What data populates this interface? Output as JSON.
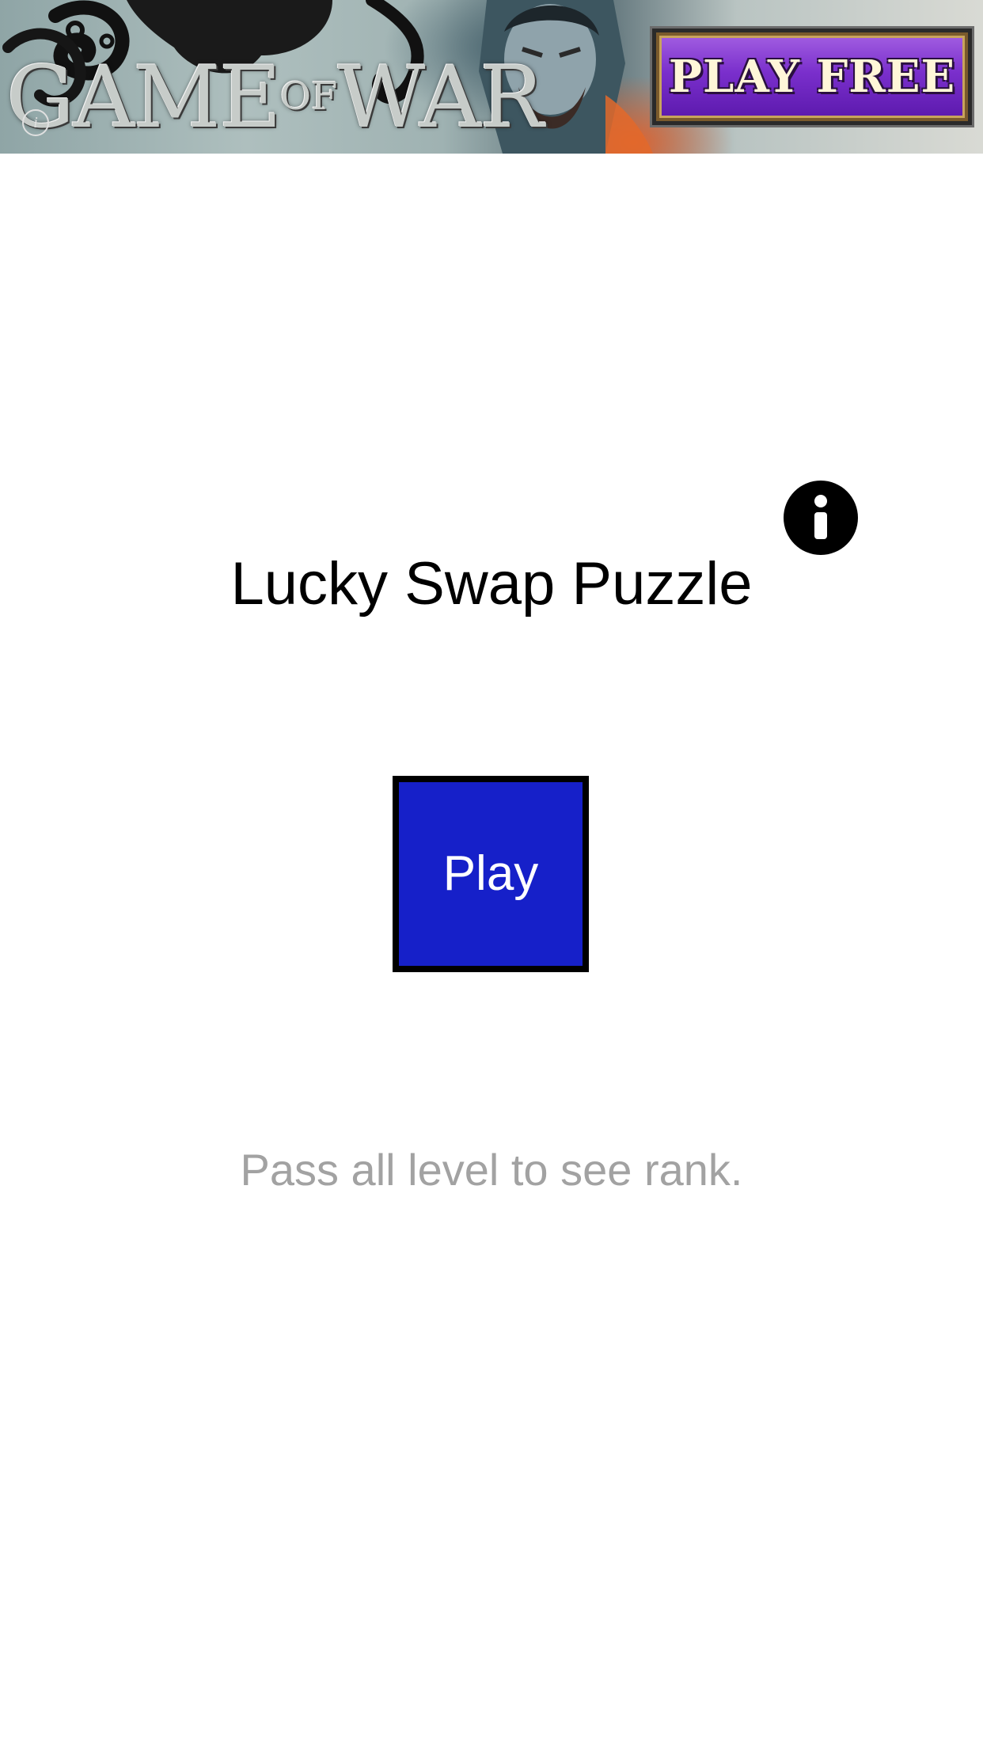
{
  "ad_banner": {
    "logo_text": {
      "game": "GAME",
      "of": "OF",
      "war": "WAR"
    },
    "cta_label": "PLAY FREE",
    "ad_choices_mark": "i",
    "colors": {
      "cta_purple": "#7a2fcc",
      "cta_text": "#fff6d8"
    }
  },
  "main": {
    "title": "Lucky Swap Puzzle",
    "info_icon": "info-circle-icon",
    "play_button_label": "Play",
    "rank_hint": "Pass all level to see rank."
  },
  "colors": {
    "background": "#ffffff",
    "play_button_fill": "#1620c9",
    "play_button_border": "#000000",
    "hint_text": "#a2a2a2"
  }
}
